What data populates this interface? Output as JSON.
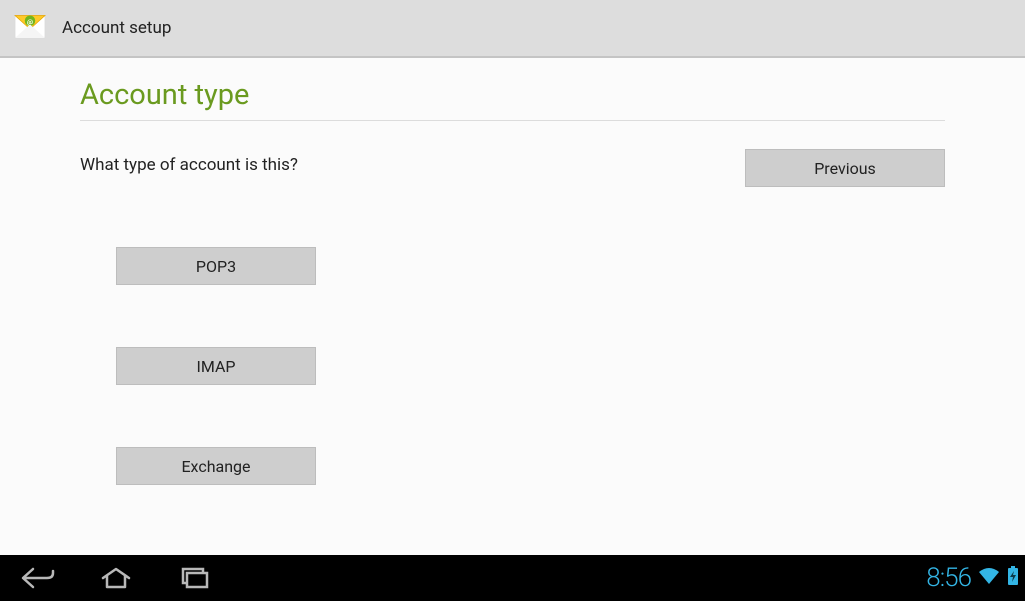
{
  "header": {
    "title": "Account setup"
  },
  "main": {
    "heading": "Account type",
    "prompt": "What type of account is this?",
    "buttons": {
      "previous": "Previous",
      "pop3": "POP3",
      "imap": "IMAP",
      "exchange": "Exchange"
    }
  },
  "systembar": {
    "clock": "8:56"
  }
}
